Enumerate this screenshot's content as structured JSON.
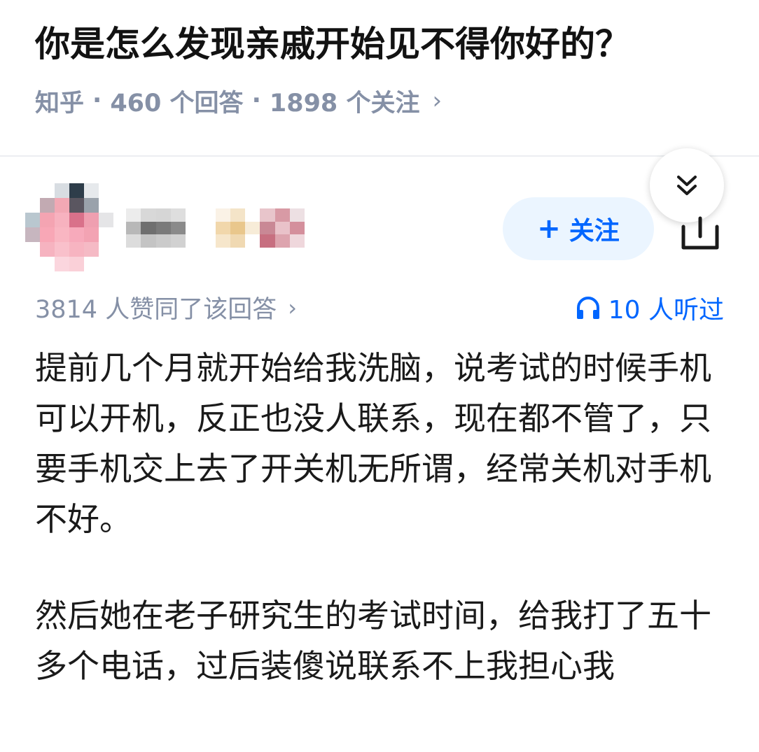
{
  "question": {
    "title": "你是怎么发现亲戚开始见不得你好的？",
    "source": "知乎",
    "separator": "·",
    "answer_count": "460 个回答",
    "follower_count": "1898 个关注",
    "chevron": "›"
  },
  "answer": {
    "follow_label": "关注",
    "follow_plus": "+",
    "upvote_text": "3814 人赞同了该回答",
    "upvote_chevron": "›",
    "listen_count": "10 人听过",
    "paragraphs": [
      "提前几个月就开始给我洗脑，说考试的时候手机可以开机，反正也没人联系，现在都不管了，只要手机交上去了开关机无所谓，经常关机对手机不好。",
      "然后她在老子研究生的考试时间，给我打了五十多个电话，过后装傻说联系不上我担心我"
    ]
  },
  "colors": {
    "accent": "#0066ff",
    "follow_bg": "#ebf5ff",
    "meta_gray": "#8590a6",
    "text": "#1a1a1a"
  },
  "icons": {
    "collapse": "double-chevron-down-icon",
    "share": "share-icon",
    "listen": "headphones-icon"
  }
}
